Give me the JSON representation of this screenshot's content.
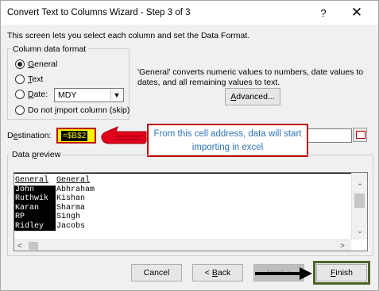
{
  "window": {
    "title": "Convert Text to Columns Wizard - Step 3 of 3",
    "help_glyph": "?",
    "close_glyph": "✕"
  },
  "intro_text": "This screen lets you select each column and set the Data Format.",
  "column_format": {
    "legend": "Column data format",
    "options": {
      "general": {
        "pre": "",
        "key": "G",
        "post": "eneral",
        "selected": true
      },
      "text": {
        "pre": "",
        "key": "T",
        "post": "ext",
        "selected": false
      },
      "date": {
        "pre": "",
        "key": "D",
        "post": "ate:",
        "selected": false
      },
      "skip": {
        "pre": "Do not ",
        "key": "i",
        "post": "mport column (skip)",
        "selected": false
      }
    },
    "date_format_value": "MDY",
    "general_note": "'General' converts numeric values to numbers, date values to dates, and all remaining values to text.",
    "advanced_button": {
      "pre": "",
      "key": "A",
      "post": "dvanced..."
    }
  },
  "destination": {
    "label_pre": "D",
    "label_key": "e",
    "label_post": "stination:",
    "value": "=$B$2"
  },
  "callout": {
    "text": "From this cell address, data will start importing in excel",
    "border_color": "#c00000",
    "text_color": "#2e74b5"
  },
  "preview": {
    "label_pre": "Data ",
    "label_key": "p",
    "label_post": "review",
    "headers": [
      "General",
      "General"
    ],
    "rows": [
      [
        "John",
        "Abhraham"
      ],
      [
        "Ruthwik",
        "Kishan"
      ],
      [
        "Karan",
        "Sharma"
      ],
      [
        "RP",
        "Singh"
      ],
      [
        "Ridley",
        "Jacobs"
      ]
    ]
  },
  "buttons": {
    "cancel": "Cancel",
    "back": {
      "pre": "< ",
      "key": "B",
      "post": "ack"
    },
    "next": "Next >",
    "finish": {
      "pre": "",
      "key": "F",
      "post": "inish"
    }
  },
  "highlight_frame_color": "#4f6228"
}
